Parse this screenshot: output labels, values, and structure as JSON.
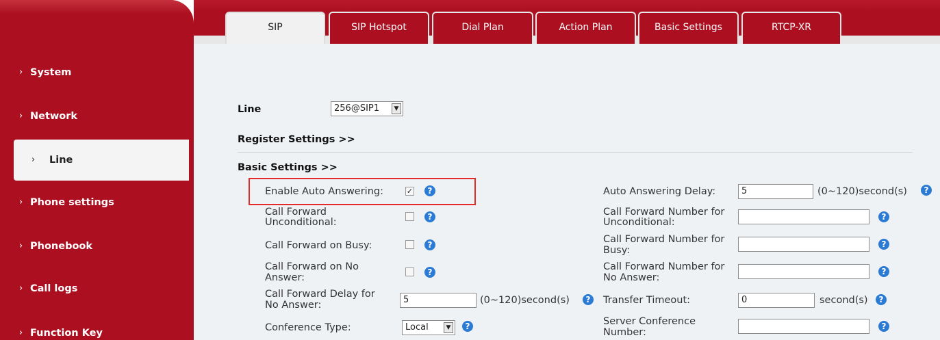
{
  "sidebar": {
    "items": [
      {
        "label": "System"
      },
      {
        "label": "Network"
      },
      {
        "label": "Line"
      },
      {
        "label": "Phone settings"
      },
      {
        "label": "Phonebook"
      },
      {
        "label": "Call logs"
      },
      {
        "label": "Function Key"
      }
    ],
    "active": "Line"
  },
  "tabs": [
    {
      "label": "SIP"
    },
    {
      "label": "SIP Hotspot"
    },
    {
      "label": "Dial Plan"
    },
    {
      "label": "Action Plan"
    },
    {
      "label": "Basic Settings"
    },
    {
      "label": "RTCP-XR"
    }
  ],
  "line": {
    "label": "Line",
    "value": "256@SIP1"
  },
  "sections": {
    "register": "Register Settings >>",
    "basic": "Basic Settings >>"
  },
  "left_fields": {
    "auto_answer": {
      "label": "Enable Auto Answering:",
      "checked": true
    },
    "cf_uncond": {
      "label1": "Call Forward",
      "label2": "Unconditional:",
      "checked": false
    },
    "cf_busy": {
      "label": "Call Forward on Busy:",
      "checked": false
    },
    "cf_noanswer": {
      "label1": "Call Forward on No",
      "label2": "Answer:",
      "checked": false
    },
    "cf_delay": {
      "label1": "Call Forward Delay for",
      "label2": "No Answer:",
      "value": "5",
      "unit": "(0~120)second(s)"
    },
    "conf_type": {
      "label": "Conference Type:",
      "value": "Local"
    }
  },
  "right_fields": {
    "auto_delay": {
      "label": "Auto Answering Delay:",
      "value": "5",
      "unit": "(0~120)second(s)"
    },
    "cfn_uncond": {
      "label1": "Call Forward Number for",
      "label2": "Unconditional:",
      "value": ""
    },
    "cfn_busy": {
      "label1": "Call Forward Number for",
      "label2": "Busy:",
      "value": ""
    },
    "cfn_noanswer": {
      "label1": "Call Forward Number for",
      "label2": "No Answer:",
      "value": ""
    },
    "transfer_timeout": {
      "label": "Transfer Timeout:",
      "value": "0",
      "unit": "second(s)"
    },
    "server_conf": {
      "label1": "Server Conference",
      "label2": "Number:",
      "value": ""
    }
  },
  "help_glyph": "?",
  "colors": {
    "brand_red": "#ac1020",
    "help_blue": "#2b7bd4",
    "highlight": "#e52a2a"
  }
}
